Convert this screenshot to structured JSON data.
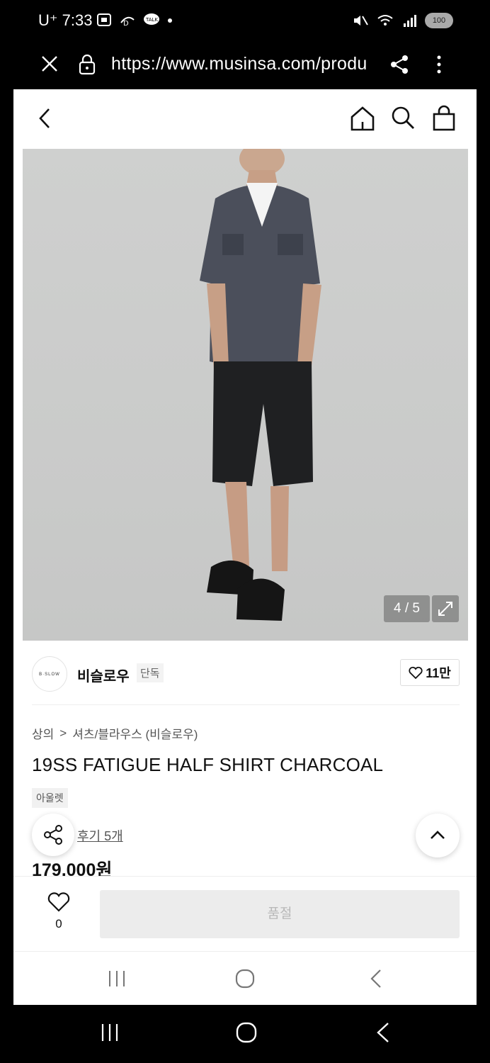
{
  "status_bar": {
    "time": "7:33",
    "carrier": "U⁺",
    "battery": "100"
  },
  "browser": {
    "url": "https://www.musinsa.com/produ"
  },
  "gallery": {
    "counter": "4 / 5"
  },
  "brand": {
    "logo_text": "B·SLOW",
    "name": "비슬로우",
    "badge": "단독",
    "likes": "11만"
  },
  "breadcrumb": {
    "category": "상의",
    "separator": ">",
    "subcategory": "셔츠/블라우스 (비슬로우)"
  },
  "product": {
    "title": "19SS FATIGUE HALF SHIRT CHARCOAL",
    "tag": "아울렛",
    "reviews": "후기 5개",
    "price": "179,000원"
  },
  "buy_bar": {
    "wish_count": "0",
    "soldout_label": "품절"
  }
}
